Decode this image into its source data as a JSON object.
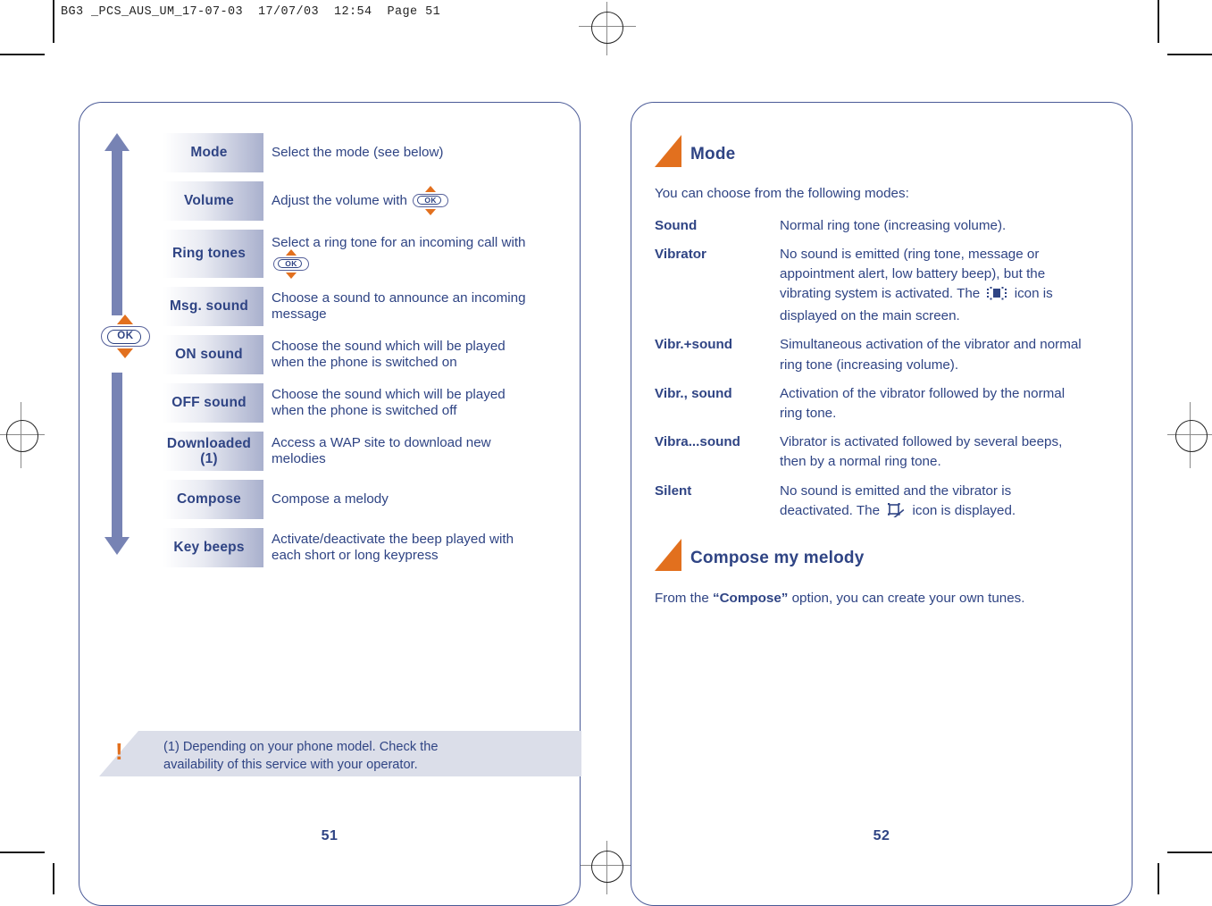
{
  "print_header": "BG3 _PCS_AUS_UM_17-07-03  17/07/03  12:54  Page 51",
  "colors": {
    "text_blue": "#2f4484",
    "accent_orange": "#e2701e",
    "panel_border": "#4a5a97",
    "arrow_blue": "#7783b4",
    "footnote_bg": "#dbdee9"
  },
  "left_page": {
    "page_number": "51",
    "ok_key_label": "OK",
    "menu_rows": [
      {
        "label": "Mode",
        "lines": [
          "Select the mode (see below)"
        ],
        "has_ok_inline": false
      },
      {
        "label": "Volume",
        "lines": [
          "Adjust the volume with "
        ],
        "has_ok_inline": true
      },
      {
        "label": "Ring tones",
        "lines": [
          "Select a ring tone for an incoming call with "
        ],
        "has_ok_inline": true
      },
      {
        "label": "Msg. sound",
        "lines": [
          "Choose a sound to announce an incoming",
          "message"
        ],
        "has_ok_inline": false
      },
      {
        "label": "ON sound",
        "lines": [
          "Choose the sound which will be played",
          "when the phone is switched on"
        ],
        "has_ok_inline": false
      },
      {
        "label": "OFF sound",
        "lines": [
          "Choose the sound which will be played",
          "when the phone is switched off"
        ],
        "has_ok_inline": false
      },
      {
        "label": "Downloaded (1)",
        "lines": [
          "Access a WAP site to download new",
          "melodies"
        ],
        "has_ok_inline": false
      },
      {
        "label": "Compose",
        "lines": [
          "Compose a melody"
        ],
        "has_ok_inline": false
      },
      {
        "label": "Key beeps",
        "lines": [
          "Activate/deactivate the beep played with",
          "each short or long keypress"
        ],
        "has_ok_inline": false
      }
    ],
    "footnote": {
      "marker": "!",
      "lines": [
        "(1) Depending on your phone model. Check the",
        "availability of this service with your operator."
      ]
    }
  },
  "right_page": {
    "page_number": "52",
    "sections": [
      {
        "title": "Mode",
        "intro": "You can choose from the following modes:",
        "definitions": [
          {
            "term": "Sound",
            "lines": [
              "Normal ring tone (increasing volume)."
            ],
            "icon": null
          },
          {
            "term": "Vibrator",
            "lines": [
              "No sound is emitted (ring tone, message or",
              "appointment alert, low battery beep), but the",
              "vibrating system is activated. The ",
              "displayed on the main screen."
            ],
            "icon": "vibrator-icon",
            "icon_line_index": 2,
            "icon_tail": " icon is"
          },
          {
            "term": "Vibr.+sound",
            "lines": [
              "Simultaneous activation of the vibrator and normal",
              "ring tone (increasing volume)."
            ],
            "icon": null
          },
          {
            "term": "Vibr., sound",
            "lines": [
              "Activation of the vibrator followed by the normal",
              "ring tone."
            ],
            "icon": null
          },
          {
            "term": "Vibra...sound",
            "lines": [
              "Vibrator is activated followed by several beeps,",
              "then by a normal ring tone."
            ],
            "icon": null
          },
          {
            "term": "Silent",
            "lines": [
              "No sound is emitted and the vibrator is",
              "deactivated. The "
            ],
            "icon": "silent-icon",
            "icon_line_index": 1,
            "icon_tail": " icon is displayed."
          }
        ]
      },
      {
        "title": "Compose my melody",
        "body_prefix": "From the ",
        "body_bold": "“Compose”",
        "body_suffix": " option, you can create your own tunes."
      }
    ]
  }
}
